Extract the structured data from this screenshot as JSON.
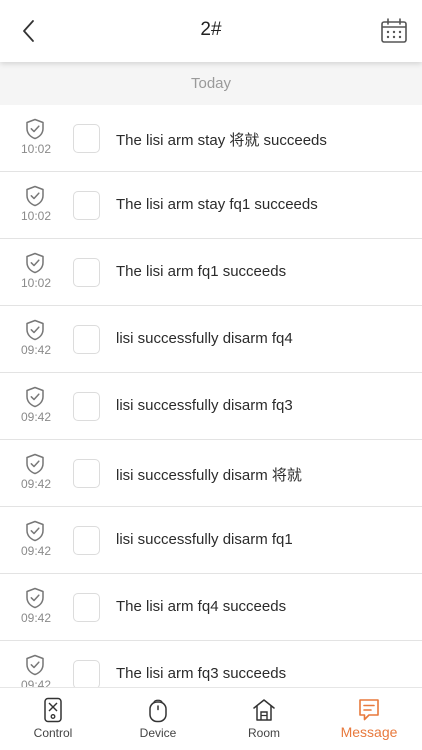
{
  "header": {
    "title": "2#",
    "back_icon": "chevron-left-icon",
    "calendar_icon": "calendar-icon"
  },
  "section": {
    "label": "Today"
  },
  "messages": [
    {
      "time": "10:02",
      "text": "The lisi arm stay 将就 succeeds"
    },
    {
      "time": "10:02",
      "text": "The lisi arm stay fq1 succeeds"
    },
    {
      "time": "10:02",
      "text": "The lisi arm fq1 succeeds"
    },
    {
      "time": "09:42",
      "text": "lisi successfully disarm fq4"
    },
    {
      "time": "09:42",
      "text": "lisi successfully disarm fq3"
    },
    {
      "time": "09:42",
      "text": "lisi successfully disarm 将就"
    },
    {
      "time": "09:42",
      "text": "lisi successfully disarm fq1"
    },
    {
      "time": "09:42",
      "text": "The lisi arm fq4 succeeds"
    },
    {
      "time": "09:42",
      "text": "The lisi arm fq3 succeeds"
    }
  ],
  "tabs": [
    {
      "label": "Control",
      "icon": "control-remote-icon"
    },
    {
      "label": "Device",
      "icon": "device-mouse-icon"
    },
    {
      "label": "Room",
      "icon": "room-house-icon"
    },
    {
      "label": "Message",
      "icon": "message-icon",
      "active": true
    }
  ],
  "colors": {
    "accent": "#e8793c",
    "section_bg": "#f5f5f5",
    "divider": "#e3e3e3"
  }
}
